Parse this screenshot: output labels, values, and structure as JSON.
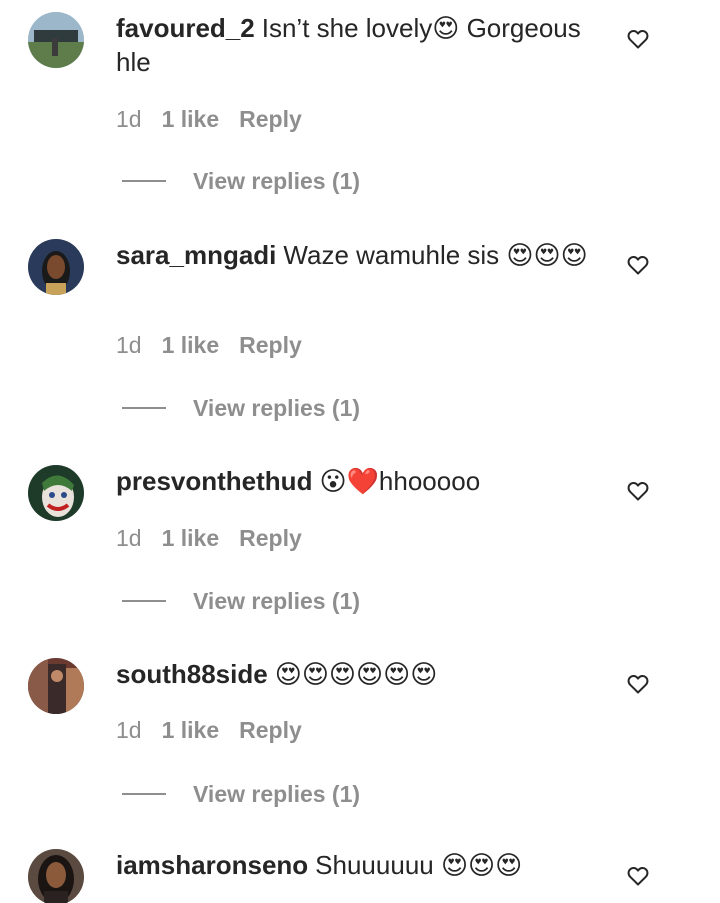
{
  "comments": [
    {
      "username": "favoured_2",
      "text": "Isn’t she lovely😍 Gorgeous hle",
      "time": "1d",
      "likes": "1 like",
      "reply": "Reply",
      "view_replies": "View replies (1)"
    },
    {
      "username": "sara_mngadi",
      "text": "Waze wamuhle sis 😍😍😍",
      "time": "1d",
      "likes": "1 like",
      "reply": "Reply",
      "view_replies": "View replies (1)"
    },
    {
      "username": "presvonthethud",
      "text": "😮❤️hhooooo",
      "time": "1d",
      "likes": "1 like",
      "reply": "Reply",
      "view_replies": "View replies (1)"
    },
    {
      "username": "south88side",
      "text": "😍😍😍😍😍😍",
      "time": "1d",
      "likes": "1 like",
      "reply": "Reply",
      "view_replies": "View replies (1)"
    },
    {
      "username": "iamsharonseno",
      "text": "Shuuuuuu 😍😍😍"
    }
  ],
  "icons": {
    "like": "heart-outline-icon"
  },
  "colors": {
    "text": "#262626",
    "secondary": "#8e8e8e",
    "background": "#ffffff"
  }
}
